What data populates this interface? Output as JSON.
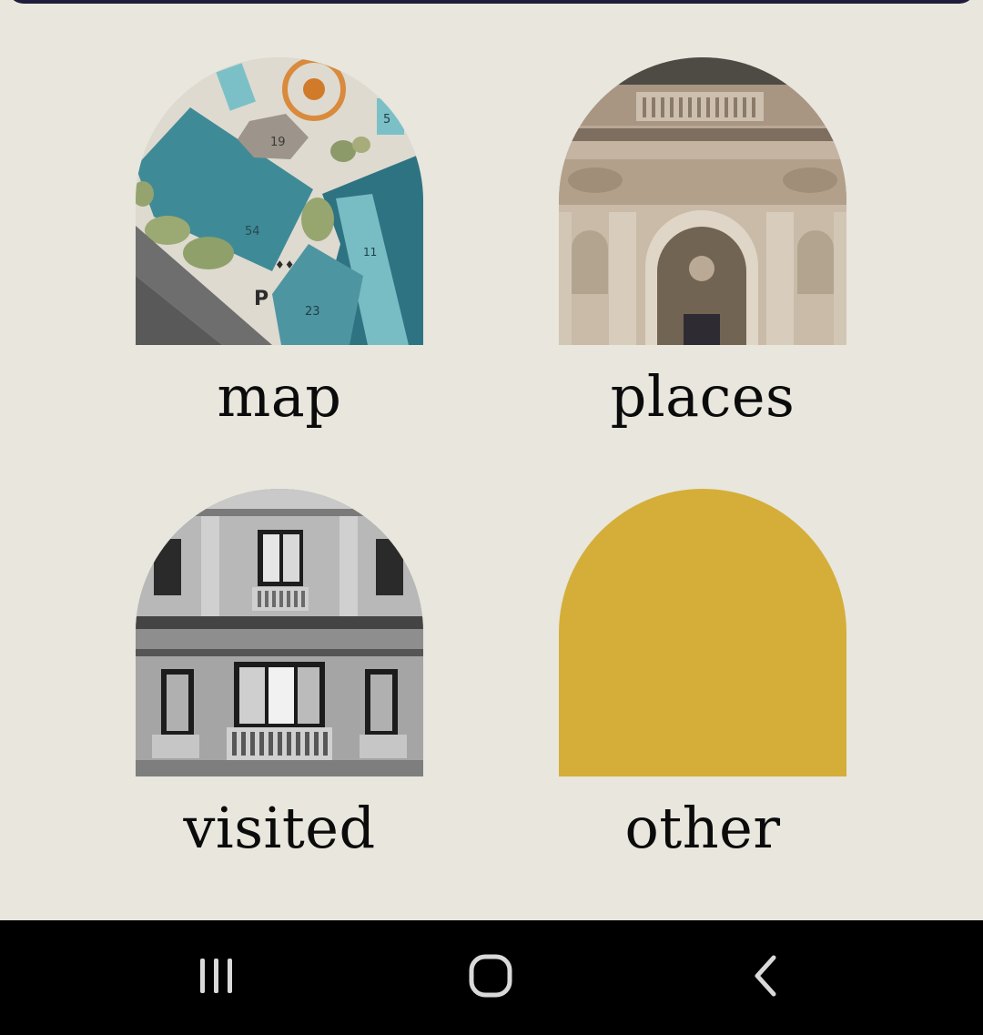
{
  "tiles": [
    {
      "id": "map",
      "label": "map",
      "image": "campus-map-thumbnail"
    },
    {
      "id": "places",
      "label": "places",
      "image": "classical-building-facade-thumbnail"
    },
    {
      "id": "visited",
      "label": "visited",
      "image": "bw-building-facade-thumbnail"
    },
    {
      "id": "other",
      "label": "other",
      "image": "solid-color-arch"
    }
  ],
  "colors": {
    "background": "#e8e6dd",
    "top_bar": "#1f1c3b",
    "other_tile": "#d4ae38",
    "nav_bar": "#000000",
    "nav_icon": "#d9d9d9"
  },
  "nav": {
    "recent_icon": "recent-apps-icon",
    "home_icon": "home-icon",
    "back_icon": "back-icon"
  }
}
